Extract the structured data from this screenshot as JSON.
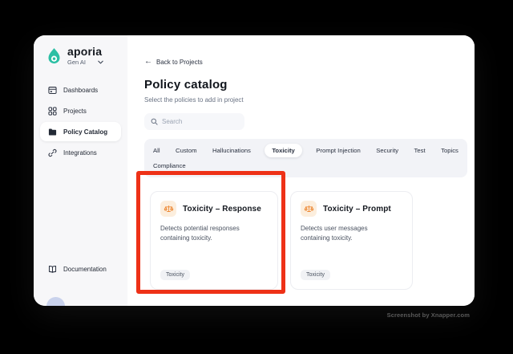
{
  "sidebar": {
    "brand": {
      "name": "aporia",
      "workspace": "Gen AI",
      "logo_icon": "aporia-drop-icon",
      "chevron_icon": "chevron-down-icon"
    },
    "items": [
      {
        "label": "Dashboards",
        "icon": "dashboard-icon",
        "selected": false
      },
      {
        "label": "Projects",
        "icon": "projects-grid-icon",
        "selected": false
      },
      {
        "label": "Policy Catalog",
        "icon": "folder-icon",
        "selected": true
      },
      {
        "label": "Integrations",
        "icon": "link-icon",
        "selected": false
      }
    ],
    "footer_item": {
      "label": "Documentation",
      "icon": "book-icon"
    }
  },
  "main": {
    "back_link": {
      "label": "Back to Projects",
      "icon": "arrow-left-icon",
      "arrow": "←"
    },
    "title": "Policy catalog",
    "subtitle": "Select the policies to add in project",
    "search": {
      "placeholder": "Search",
      "icon": "search-icon"
    },
    "tabs": [
      {
        "label": "All",
        "selected": false
      },
      {
        "label": "Custom",
        "selected": false
      },
      {
        "label": "Hallucinations",
        "selected": false
      },
      {
        "label": "Toxicity",
        "selected": true
      },
      {
        "label": "Prompt Injection",
        "selected": false
      },
      {
        "label": "Security",
        "selected": false
      },
      {
        "label": "Test",
        "selected": false
      },
      {
        "label": "Topics",
        "selected": false
      },
      {
        "label": "Compliance",
        "selected": false
      }
    ],
    "cards": [
      {
        "title": "Toxicity – Response",
        "description": "Detects potential responses containing toxicity.",
        "tag": "Toxicity",
        "icon": "scales-icon",
        "highlighted": true
      },
      {
        "title": "Toxicity – Prompt",
        "description": "Detects user messages containing toxicity.",
        "tag": "Toxicity",
        "icon": "scales-icon",
        "highlighted": false
      }
    ]
  },
  "watermark": "Screenshot by Xnapper.com",
  "colors": {
    "brand_teal": "#2BBFA4",
    "highlight_red": "#EE3117",
    "card_icon_orange": "#ED8936",
    "card_icon_bg": "#FCEEDD",
    "sidebar_bg": "#F7F7F9",
    "tabsbar_bg": "#F2F3F7",
    "outer_bg": "#000000"
  }
}
